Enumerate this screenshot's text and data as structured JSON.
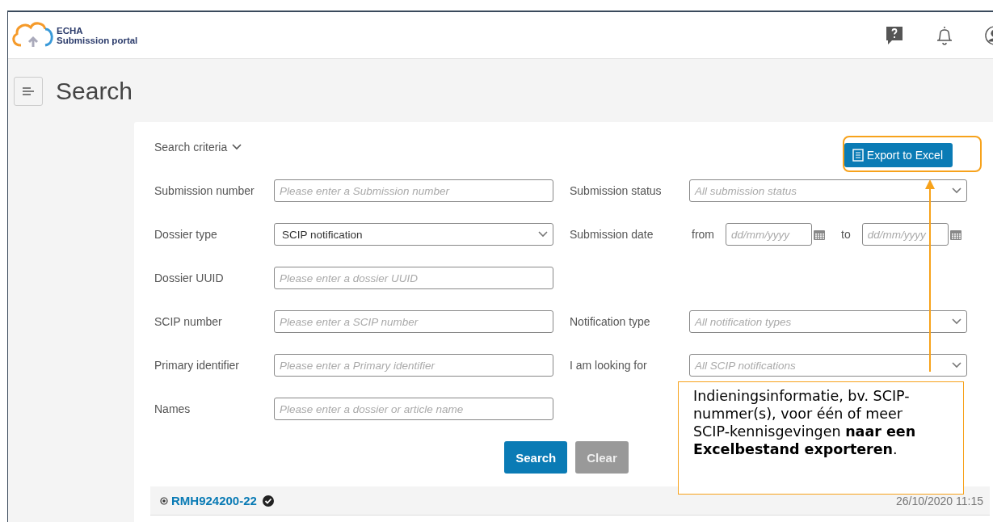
{
  "header": {
    "logo_title": "ECHA",
    "logo_subtitle": "Submission portal"
  },
  "page_title": "Search",
  "search_criteria": {
    "label": "Search criteria",
    "expanded": true
  },
  "export_button": {
    "label": "Export to Excel",
    "highlighted": true
  },
  "rows": [
    {
      "left": {
        "label": "Submission number",
        "kind": "text",
        "placeholder": "Please enter a Submission number"
      },
      "right": {
        "label": "Submission status",
        "kind": "select",
        "placeholder": "All submission status"
      }
    },
    {
      "left": {
        "label": "Dossier type",
        "kind": "select",
        "value": "SCIP notification"
      },
      "right": {
        "label": "Submission date",
        "kind": "daterange",
        "from_label": "from",
        "from_placeholder": "dd/mm/yyyy",
        "to_label": "to",
        "to_placeholder": "dd/mm/yyyy"
      }
    },
    {
      "left": {
        "label": "Dossier UUID",
        "kind": "text",
        "placeholder": "Please enter a dossier UUID"
      }
    },
    {
      "left": {
        "label": "SCIP number",
        "kind": "text",
        "placeholder": "Please enter a SCIP number"
      },
      "right": {
        "label": "Notification type",
        "kind": "select",
        "placeholder": "All notification types"
      }
    },
    {
      "left": {
        "label": "Primary identifier",
        "kind": "text",
        "placeholder": "Please enter a Primary identifier"
      },
      "right": {
        "label": "I am looking for",
        "kind": "select",
        "placeholder": "All SCIP notifications"
      }
    },
    {
      "left": {
        "label": "Names",
        "kind": "text",
        "placeholder": "Please enter a dossier or article name"
      }
    }
  ],
  "buttons": [
    {
      "label": "Search",
      "disabled": false
    },
    {
      "label": "Clear",
      "disabled": true
    }
  ],
  "results": [
    {
      "id": "RMH924200-22",
      "verified": true,
      "date": "26/10/2020 11:15"
    }
  ],
  "annotation": {
    "text": "Indieningsinformatie, bv. SCIP-nummer(s), voor één of meer SCIP-kennisgevingen **naar een Excelbestand exporteren**."
  }
}
